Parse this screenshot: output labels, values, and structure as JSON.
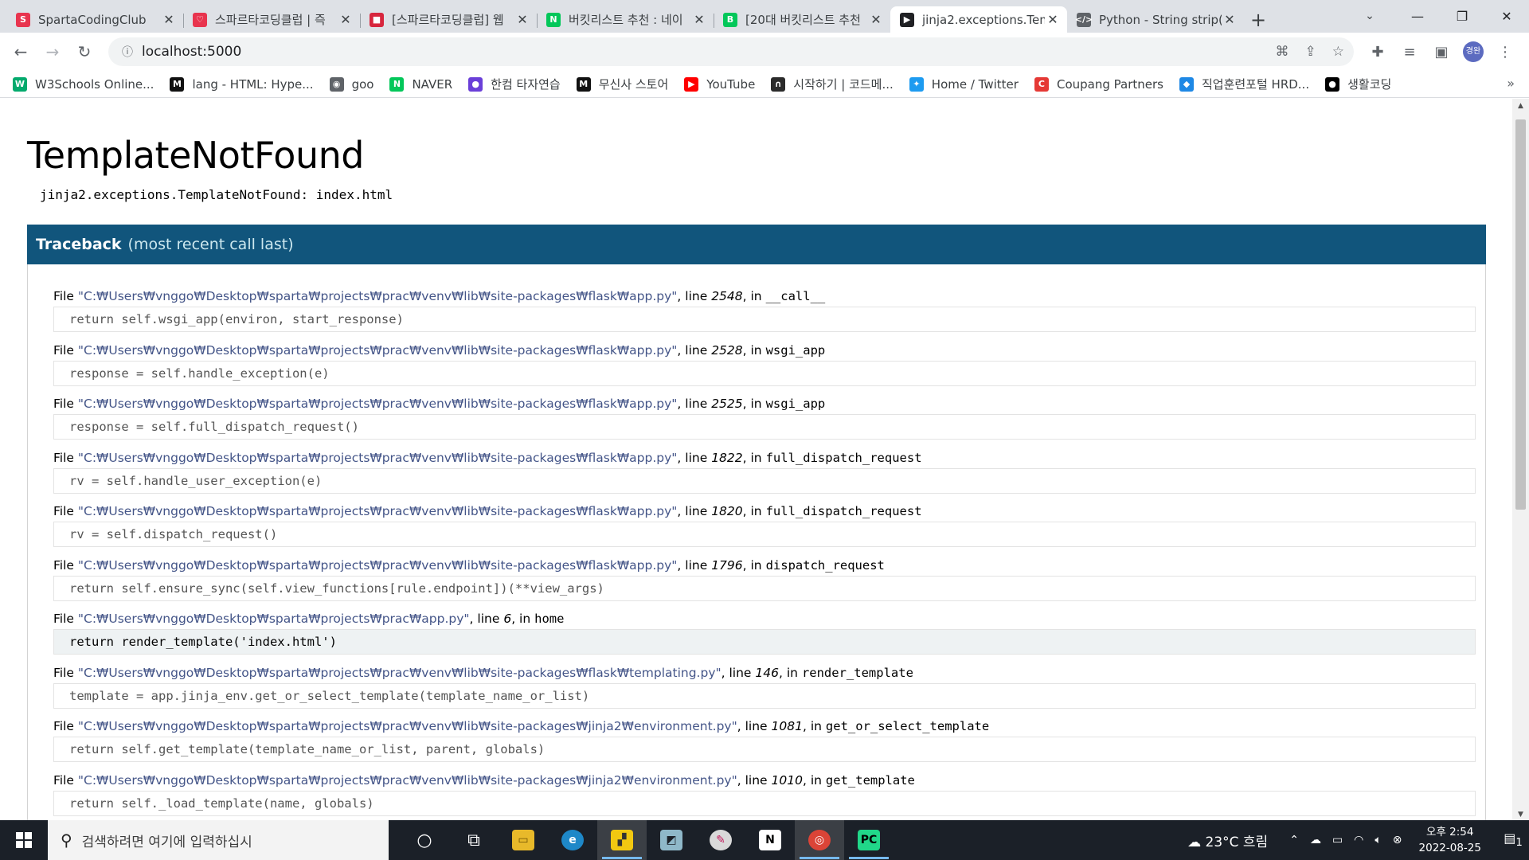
{
  "browser": {
    "tabs": [
      {
        "title": "SpartaCodingClub",
        "favicon_color": "#e8344e",
        "favicon_text": "S"
      },
      {
        "title": "스파르타코딩클럽 | 즉",
        "favicon_color": "#e8344e",
        "favicon_text": "♡"
      },
      {
        "title": "[스파르타코딩클럽] 웹",
        "favicon_color": "#d7263d",
        "favicon_text": "■"
      },
      {
        "title": "버킷리스트 추천 : 네이",
        "favicon_color": "#03c75a",
        "favicon_text": "N"
      },
      {
        "title": "[20대 버킷리스트 추천",
        "favicon_color": "#03c75a",
        "favicon_text": "B"
      },
      {
        "title": "jinja2.exceptions.Tem",
        "favicon_color": "#202124",
        "favicon_text": "▶"
      },
      {
        "title": "Python - String strip(",
        "favicon_color": "#5f6368",
        "favicon_text": "</>"
      }
    ],
    "active_tab_index": 5,
    "url": "localhost:5000",
    "profile_initials": "경완"
  },
  "bookmarks": [
    {
      "label": "W3Schools Online...",
      "color": "#04aa6d",
      "icon": "W"
    },
    {
      "label": "lang - HTML: Hype...",
      "color": "#111111",
      "icon": "M"
    },
    {
      "label": "goo",
      "color": "#5f6368",
      "icon": "◉"
    },
    {
      "label": "NAVER",
      "color": "#03c75a",
      "icon": "N"
    },
    {
      "label": "한컴 타자연습",
      "color": "#6a3fd8",
      "icon": "●"
    },
    {
      "label": "무신사 스토어",
      "color": "#111111",
      "icon": "M"
    },
    {
      "label": "YouTube",
      "color": "#ff0000",
      "icon": "▶"
    },
    {
      "label": "시작하기 | 코드메...",
      "color": "#2b2b2b",
      "icon": "∩"
    },
    {
      "label": "Home / Twitter",
      "color": "#1d9bf0",
      "icon": "✦"
    },
    {
      "label": "Coupang Partners",
      "color": "#e53935",
      "icon": "C"
    },
    {
      "label": "직업훈련포털 HRD...",
      "color": "#1e88e5",
      "icon": "◆"
    },
    {
      "label": "생활코딩",
      "color": "#000000",
      "icon": "●"
    }
  ],
  "error": {
    "title": "TemplateNotFound",
    "message": "jinja2.exceptions.TemplateNotFound: index.html",
    "traceback_label": "Traceback",
    "traceback_note": "(most recent call last)",
    "frames": [
      {
        "file": "\"C:₩Users₩vnggo₩Desktop₩sparta₩projects₩prac₩venv₩lib₩site-packages₩flask₩app.py\"",
        "line": "2548",
        "func": "__call__",
        "code": "return self.wsgi_app(environ, start_response)",
        "app": false
      },
      {
        "file": "\"C:₩Users₩vnggo₩Desktop₩sparta₩projects₩prac₩venv₩lib₩site-packages₩flask₩app.py\"",
        "line": "2528",
        "func": "wsgi_app",
        "code": "response = self.handle_exception(e)",
        "app": false
      },
      {
        "file": "\"C:₩Users₩vnggo₩Desktop₩sparta₩projects₩prac₩venv₩lib₩site-packages₩flask₩app.py\"",
        "line": "2525",
        "func": "wsgi_app",
        "code": "response = self.full_dispatch_request()",
        "app": false
      },
      {
        "file": "\"C:₩Users₩vnggo₩Desktop₩sparta₩projects₩prac₩venv₩lib₩site-packages₩flask₩app.py\"",
        "line": "1822",
        "func": "full_dispatch_request",
        "code": "rv = self.handle_user_exception(e)",
        "app": false
      },
      {
        "file": "\"C:₩Users₩vnggo₩Desktop₩sparta₩projects₩prac₩venv₩lib₩site-packages₩flask₩app.py\"",
        "line": "1820",
        "func": "full_dispatch_request",
        "code": "rv = self.dispatch_request()",
        "app": false
      },
      {
        "file": "\"C:₩Users₩vnggo₩Desktop₩sparta₩projects₩prac₩venv₩lib₩site-packages₩flask₩app.py\"",
        "line": "1796",
        "func": "dispatch_request",
        "code": "return self.ensure_sync(self.view_functions[rule.endpoint])(**view_args)",
        "app": false
      },
      {
        "file": "\"C:₩Users₩vnggo₩Desktop₩sparta₩projects₩prac₩app.py\"",
        "line": "6",
        "func": "home",
        "code": "return render_template('index.html')",
        "app": true
      },
      {
        "file": "\"C:₩Users₩vnggo₩Desktop₩sparta₩projects₩prac₩venv₩lib₩site-packages₩flask₩templating.py\"",
        "line": "146",
        "func": "render_template",
        "code": "template = app.jinja_env.get_or_select_template(template_name_or_list)",
        "app": false
      },
      {
        "file": "\"C:₩Users₩vnggo₩Desktop₩sparta₩projects₩prac₩venv₩lib₩site-packages₩jinja2₩environment.py\"",
        "line": "1081",
        "func": "get_or_select_template",
        "code": "return self.get_template(template_name_or_list, parent, globals)",
        "app": false
      },
      {
        "file": "\"C:₩Users₩vnggo₩Desktop₩sparta₩projects₩prac₩venv₩lib₩site-packages₩jinja2₩environment.py\"",
        "line": "1010",
        "func": "get_template",
        "code": "return self._load_template(name, globals)",
        "app": false
      }
    ],
    "file_word": "File",
    "line_word": "line",
    "in_word": "in",
    "header_color": "#11557c",
    "app_frame_bg": "#eef2f3"
  },
  "taskbar": {
    "search_placeholder": "검색하려면 여기에 입력하십시",
    "weather": "23°C 흐림",
    "time": "오후 2:54",
    "date": "2022-08-25",
    "notification_count": "1"
  }
}
